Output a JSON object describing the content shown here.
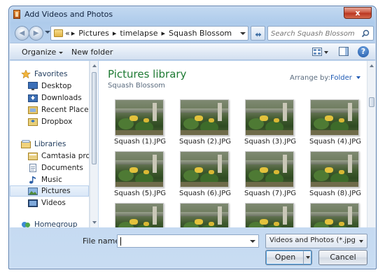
{
  "window": {
    "title": "Add Videos and Photos",
    "close_label": "x"
  },
  "address": {
    "prefix": "«",
    "crumbs": [
      "Pictures",
      "timelapse",
      "Squash Blossom"
    ],
    "separator": "▸"
  },
  "search": {
    "placeholder": "Search Squash Blossom"
  },
  "toolbar": {
    "organize_label": "Organize",
    "new_folder_label": "New folder",
    "help_label": "?"
  },
  "navpane": {
    "favorites": {
      "label": "Favorites",
      "items": [
        "Desktop",
        "Downloads",
        "Recent Places",
        "Dropbox"
      ]
    },
    "libraries": {
      "label": "Libraries",
      "items": [
        "Camtasia project",
        "Documents",
        "Music",
        "Pictures",
        "Videos"
      ],
      "selected": "Pictures"
    },
    "homegroup_label": "Homegroup"
  },
  "content": {
    "library_title": "Pictures library",
    "library_subtitle": "Squash Blossom",
    "arrange_label": "Arrange by:",
    "arrange_value": "Folder",
    "files": [
      "Squash (1).JPG",
      "Squash (2).JPG",
      "Squash (3).JPG",
      "Squash (4).JPG",
      "Squash (5).JPG",
      "Squash (6).JPG",
      "Squash (7).JPG",
      "Squash (8).JPG",
      "",
      "",
      "",
      ""
    ]
  },
  "bottom": {
    "filename_label": "File name:",
    "filename_value": "",
    "filter_value": "Videos and Photos (*.jpg;*.png;",
    "open_label": "Open",
    "cancel_label": "Cancel"
  },
  "colors": {
    "library_title": "#1e7a33",
    "accent_link": "#1e5ab4",
    "chrome": "#aecbeb"
  }
}
